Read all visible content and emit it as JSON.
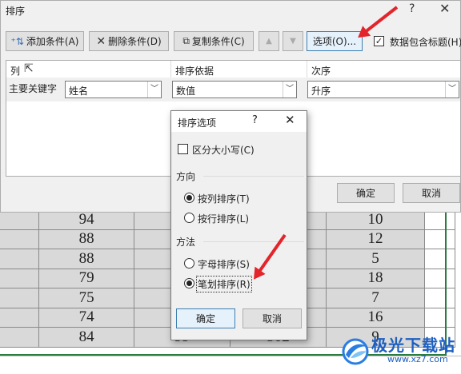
{
  "sort_dialog": {
    "title": "排序",
    "help": "?",
    "close": "✕",
    "toolbar": {
      "add_level": "添加条件(A)",
      "delete_level": "删除条件(D)",
      "copy_level": "复制条件(C)",
      "move_up": "▲",
      "move_down": "▼",
      "options": "选项(O)...",
      "has_headers_checked": true,
      "has_headers": "数据包含标题(H)"
    },
    "columns": {
      "column": "列",
      "sort_on": "排序依据",
      "order": "次序"
    },
    "row": {
      "label": "主要关键字",
      "column_value": "姓名",
      "sort_on_value": "数值",
      "order_value": "升序"
    },
    "ok": "确定",
    "cancel": "取消"
  },
  "options_dialog": {
    "title": "排序选项",
    "help": "?",
    "close": "✕",
    "case_sensitive": "区分大小写(C)",
    "case_sensitive_checked": false,
    "orientation_label": "方向",
    "sort_top_to_bottom": "按列排序(T)",
    "sort_left_to_right": "按行排序(L)",
    "orientation_selected": "top_to_bottom",
    "method_label": "方法",
    "letter_sort": "字母排序(S)",
    "stroke_sort": "笔划排序(R)",
    "method_selected": "stroke",
    "ok": "确定",
    "cancel": "取消"
  },
  "sheet": {
    "rows": [
      [
        "94",
        "",
        "",
        "10"
      ],
      [
        "88",
        "",
        "",
        "12"
      ],
      [
        "88",
        "",
        "",
        "5"
      ],
      [
        "79",
        "",
        "",
        "18"
      ],
      [
        "75",
        "",
        "",
        "7"
      ],
      [
        "74",
        "",
        "",
        "16"
      ],
      [
        "84",
        "99",
        "502",
        "9"
      ]
    ]
  },
  "watermark": {
    "brand": "极光下载站",
    "url": "www.xz7.com"
  },
  "colors": {
    "arrow": "#e3242b",
    "selection_border": "#2a7d3f",
    "dialog_bg": "#f0f0f0"
  }
}
